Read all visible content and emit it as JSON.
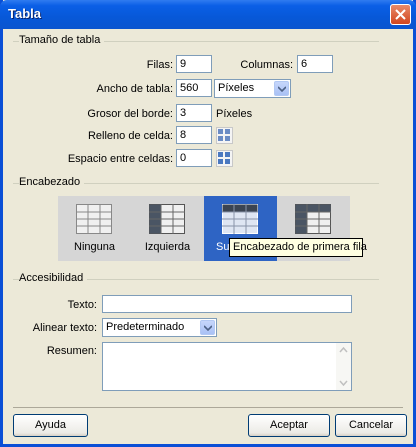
{
  "window": {
    "title": "Tabla"
  },
  "sections": {
    "size": "Tamaño de tabla",
    "header": "Encabezado",
    "accessibility": "Accesibilidad"
  },
  "size": {
    "rows_label": "Filas:",
    "rows_value": "9",
    "cols_label": "Columnas:",
    "cols_value": "6",
    "width_label": "Ancho de tabla:",
    "width_value": "560",
    "width_unit": "Píxeles",
    "border_label": "Grosor del borde:",
    "border_value": "3",
    "border_unit": "Píxeles",
    "padding_label": "Relleno de celda:",
    "padding_value": "8",
    "spacing_label": "Espacio entre celdas:",
    "spacing_value": "0"
  },
  "header": {
    "options": [
      {
        "label": "Ninguna",
        "icon": "table-no-header-icon"
      },
      {
        "label": "Izquierda",
        "icon": "table-left-header-icon"
      },
      {
        "label": "Su",
        "icon": "table-top-header-icon",
        "selected": true
      },
      {
        "label": "",
        "icon": "table-both-header-icon"
      }
    ],
    "tooltip": "Encabezado de primera fila"
  },
  "accessibility": {
    "caption_label": "Texto:",
    "caption_value": "",
    "align_label": "Alinear texto:",
    "align_value": "Predeterminado",
    "summary_label": "Resumen:",
    "summary_value": ""
  },
  "buttons": {
    "help": "Ayuda",
    "ok": "Aceptar",
    "cancel": "Cancelar"
  },
  "colors": {
    "titlebar": "#0a5fe6",
    "selected_option": "#2e64c4",
    "tooltip_bg": "#ffffe1"
  }
}
